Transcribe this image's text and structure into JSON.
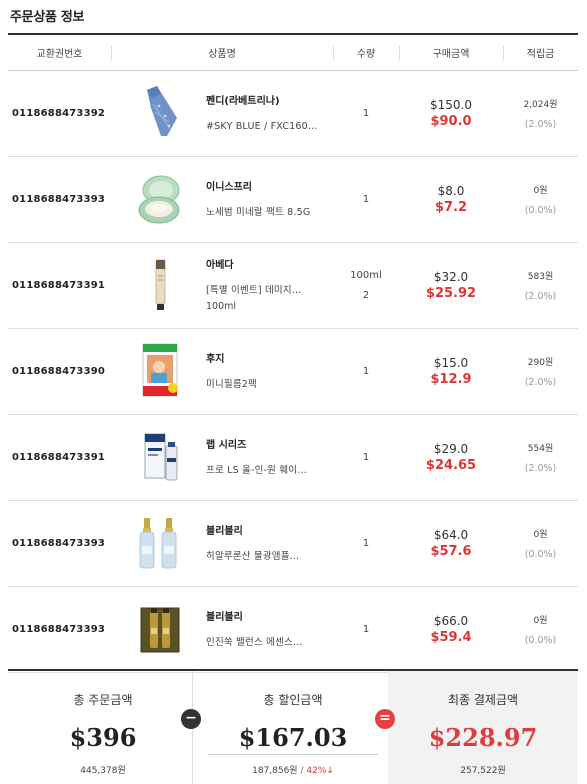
{
  "section_title": "주문상품 정보",
  "table": {
    "headers": {
      "exchange_no": "교환권번호",
      "product": "상품명",
      "qty": "수량",
      "price": "구매금액",
      "points": "적립금"
    },
    "rows": [
      {
        "exchange_no": "0118688473392",
        "thumb_icon": "necktie-icon",
        "brand": "펜디(라베트리나)",
        "name": "#SKY BLUE / FXC160…",
        "name2": "",
        "option": "",
        "qty": "1",
        "price_orig": "$150.0",
        "price_sale": "$90.0",
        "points": "2,024원",
        "rate": "(2.0%)"
      },
      {
        "exchange_no": "0118688473393",
        "thumb_icon": "powder-compact-icon",
        "brand": "이니스프리",
        "name": "노세범 미네랄 팩트 8.5G",
        "name2": "",
        "option": "",
        "qty": "1",
        "price_orig": "$8.0",
        "price_sale": "$7.2",
        "points": "0원",
        "rate": "(0.0%)"
      },
      {
        "exchange_no": "0118688473391",
        "thumb_icon": "cream-tube-icon",
        "brand": "아베다",
        "name": "[특별 이벤트] 데미지…",
        "name2": "100ml",
        "option": "100ml",
        "qty": "2",
        "price_orig": "$32.0",
        "price_sale": "$25.92",
        "points": "583원",
        "rate": "(2.0%)"
      },
      {
        "exchange_no": "0118688473390",
        "thumb_icon": "instant-film-pack-icon",
        "brand": "후지",
        "name": "미니필름2팩",
        "name2": "",
        "option": "",
        "qty": "1",
        "price_orig": "$15.0",
        "price_sale": "$12.9",
        "points": "290원",
        "rate": "(2.0%)"
      },
      {
        "exchange_no": "0118688473391",
        "thumb_icon": "lotion-bottle-icon",
        "brand": "랩 시리즈",
        "name": "프로 LS 올-인-원 훼이…",
        "name2": "",
        "option": "",
        "qty": "1",
        "price_orig": "$29.0",
        "price_sale": "$24.65",
        "points": "554원",
        "rate": "(2.0%)"
      },
      {
        "exchange_no": "0118688473393",
        "thumb_icon": "serum-dropper-bottles-icon",
        "brand": "블리블리",
        "name": "히알루론산 물광앰플…",
        "name2": "",
        "option": "",
        "qty": "1",
        "price_orig": "$64.0",
        "price_sale": "$57.6",
        "points": "0원",
        "rate": "(0.0%)"
      },
      {
        "exchange_no": "0118688473393",
        "thumb_icon": "essence-gift-box-icon",
        "brand": "블리블리",
        "name": "인진쑥 밸런스 에센스…",
        "name2": "",
        "option": "",
        "qty": "1",
        "price_orig": "$66.0",
        "price_sale": "$59.4",
        "points": "0원",
        "rate": "(0.0%)"
      }
    ]
  },
  "summary": {
    "total_order": {
      "label": "총 주문금액",
      "value": "$396",
      "sub": "445,378원"
    },
    "total_discount": {
      "label": "총 할인금액",
      "value": "$167.03",
      "sub_won": "187,856원",
      "sep": " / ",
      "pct": "42%↓"
    },
    "final": {
      "label": "최종 결제금액",
      "value": "$228.97",
      "sub": "257,522원"
    },
    "minus_symbol": "−",
    "equals_symbol": "="
  },
  "colors": {
    "sale_red": "#e03535",
    "final_red": "#e23b3b",
    "header_border": "#333333"
  }
}
